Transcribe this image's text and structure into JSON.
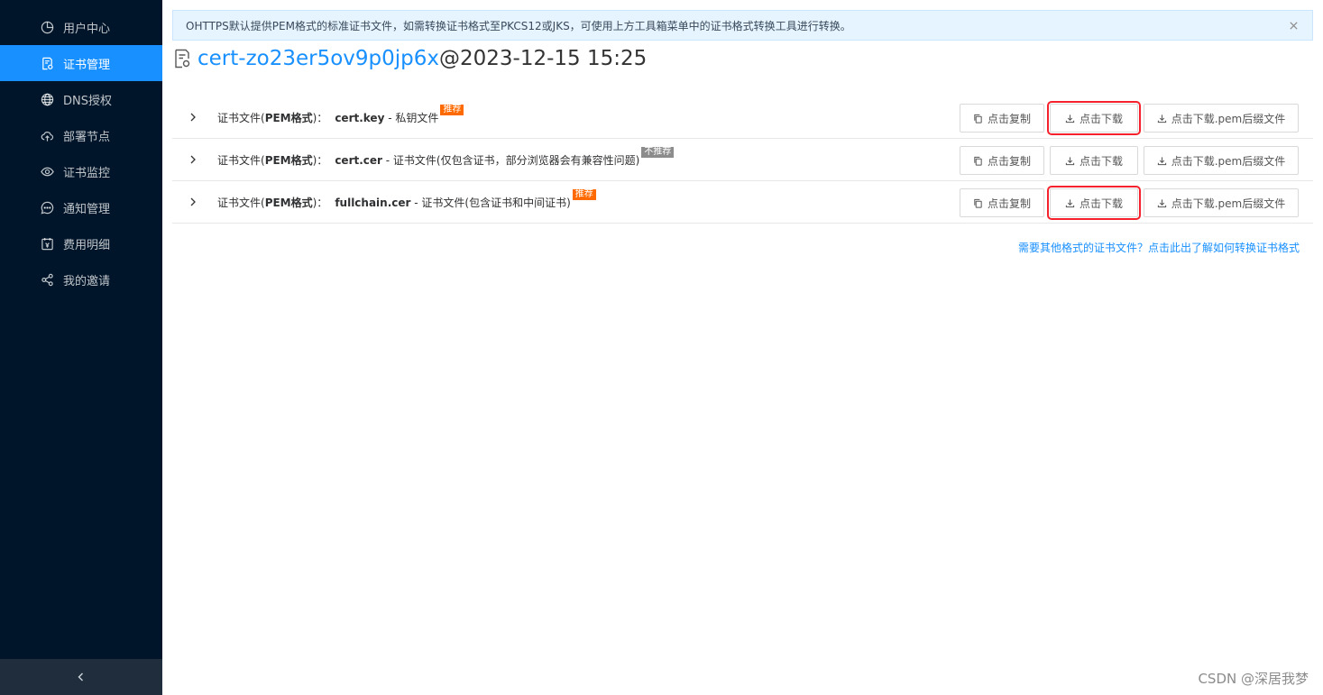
{
  "sidebar": {
    "items": [
      {
        "label": "用户中心",
        "icon": "pie-chart-icon",
        "active": false
      },
      {
        "label": "证书管理",
        "icon": "certificate-icon",
        "active": true
      },
      {
        "label": "DNS授权",
        "icon": "globe-icon",
        "active": false
      },
      {
        "label": "部署节点",
        "icon": "cloud-upload-icon",
        "active": false
      },
      {
        "label": "证书监控",
        "icon": "eye-icon",
        "active": false
      },
      {
        "label": "通知管理",
        "icon": "message-icon",
        "active": false
      },
      {
        "label": "费用明细",
        "icon": "bill-icon",
        "active": false
      },
      {
        "label": "我的邀请",
        "icon": "share-icon",
        "active": false
      }
    ],
    "collapse_icon": "chevron-left-icon"
  },
  "alert": {
    "text": "OHTTPS默认提供PEM格式的标准证书文件，如需转换证书格式至PKCS12或JKS，可使用上方工具箱菜单中的证书格式转换工具进行转换。",
    "close_icon": "close-icon"
  },
  "title": {
    "name": "cert-zo23er5ov9p0jp6x",
    "date": "@2023-12-15 15:25"
  },
  "rows": [
    {
      "prefix": "证书文件(",
      "format": "PEM格式",
      "suffix": ")：",
      "filename": "cert.key",
      "desc": " - 私钥文件",
      "tag": "推荐"
    },
    {
      "prefix": "证书文件(",
      "format": "PEM格式",
      "suffix": ")：",
      "filename": "cert.cer",
      "desc": " - 证书文件(仅包含证书，部分浏览器会有兼容性问题)",
      "tag": "不推荐"
    },
    {
      "prefix": "证书文件(",
      "format": "PEM格式",
      "suffix": ")：",
      "filename": "fullchain.cer",
      "desc": " - 证书文件(包含证书和中间证书)",
      "tag": "推荐"
    }
  ],
  "buttons": {
    "copy": "点击复制",
    "download": "点击下载",
    "download_pem": "点击下载.pem后缀文件"
  },
  "help_link": "需要其他格式的证书文件？点击此出了解如何转换证书格式",
  "watermark": "CSDN @深居我梦",
  "colors": {
    "sidebar_bg": "#001529",
    "active_item": "#1890ff",
    "tag_recommended": "#ff6a00",
    "tag_not_recommended": "#8c8c8c",
    "highlight_border": "#f5222d"
  }
}
